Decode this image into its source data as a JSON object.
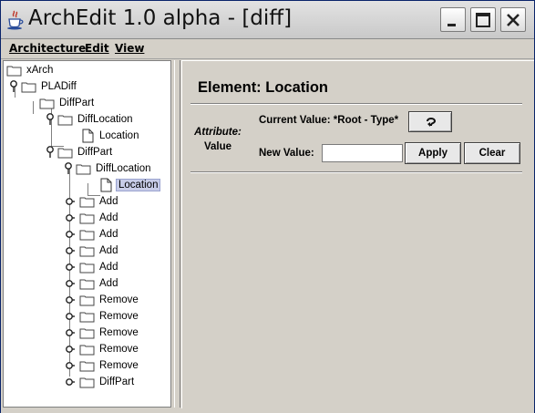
{
  "window": {
    "title": "ArchEdit 1.0 alpha - [diff]",
    "icon": "java-coffee-cup-icon"
  },
  "menubar": {
    "items": [
      {
        "label": "Architecture"
      },
      {
        "label": "Edit"
      },
      {
        "label": "View"
      }
    ]
  },
  "tree": {
    "nodes": [
      {
        "label": "xArch",
        "icon": "folder-icon",
        "toggle": "none"
      },
      {
        "label": "PLADiff",
        "icon": "folder-icon",
        "toggle": "expanded"
      },
      {
        "label": "DiffPart",
        "icon": "folder-icon",
        "toggle": "none"
      },
      {
        "label": "DiffLocation",
        "icon": "folder-icon",
        "toggle": "expanded"
      },
      {
        "label": "Location",
        "icon": "document-icon",
        "toggle": "none"
      },
      {
        "label": "DiffPart",
        "icon": "folder-icon",
        "toggle": "expanded"
      },
      {
        "label": "DiffLocation",
        "icon": "folder-icon",
        "toggle": "expanded"
      },
      {
        "label": "Location",
        "icon": "document-icon",
        "toggle": "none",
        "selected": true
      },
      {
        "label": "Add",
        "icon": "folder-icon",
        "toggle": "collapsed"
      },
      {
        "label": "Add",
        "icon": "folder-icon",
        "toggle": "collapsed"
      },
      {
        "label": "Add",
        "icon": "folder-icon",
        "toggle": "collapsed"
      },
      {
        "label": "Add",
        "icon": "folder-icon",
        "toggle": "collapsed"
      },
      {
        "label": "Add",
        "icon": "folder-icon",
        "toggle": "collapsed"
      },
      {
        "label": "Add",
        "icon": "folder-icon",
        "toggle": "collapsed"
      },
      {
        "label": "Remove",
        "icon": "folder-icon",
        "toggle": "collapsed"
      },
      {
        "label": "Remove",
        "icon": "folder-icon",
        "toggle": "collapsed"
      },
      {
        "label": "Remove",
        "icon": "folder-icon",
        "toggle": "collapsed"
      },
      {
        "label": "Remove",
        "icon": "folder-icon",
        "toggle": "collapsed"
      },
      {
        "label": "Remove",
        "icon": "folder-icon",
        "toggle": "collapsed"
      },
      {
        "label": "DiffPart",
        "icon": "folder-icon",
        "toggle": "collapsed"
      }
    ]
  },
  "editor": {
    "element_title": "Element: Location",
    "attribute_label": "Attribute:",
    "value_label": "Value",
    "current_value_label": "Current Value: *Root - Type*",
    "type_button_icon": "type-chooser-icon",
    "new_value_label": "New Value:",
    "new_value_input": "",
    "apply_label": "Apply",
    "clear_label": "Clear"
  },
  "colors": {
    "selection_bg": "#c8cde8",
    "panel_bg": "#d4d0c8"
  }
}
